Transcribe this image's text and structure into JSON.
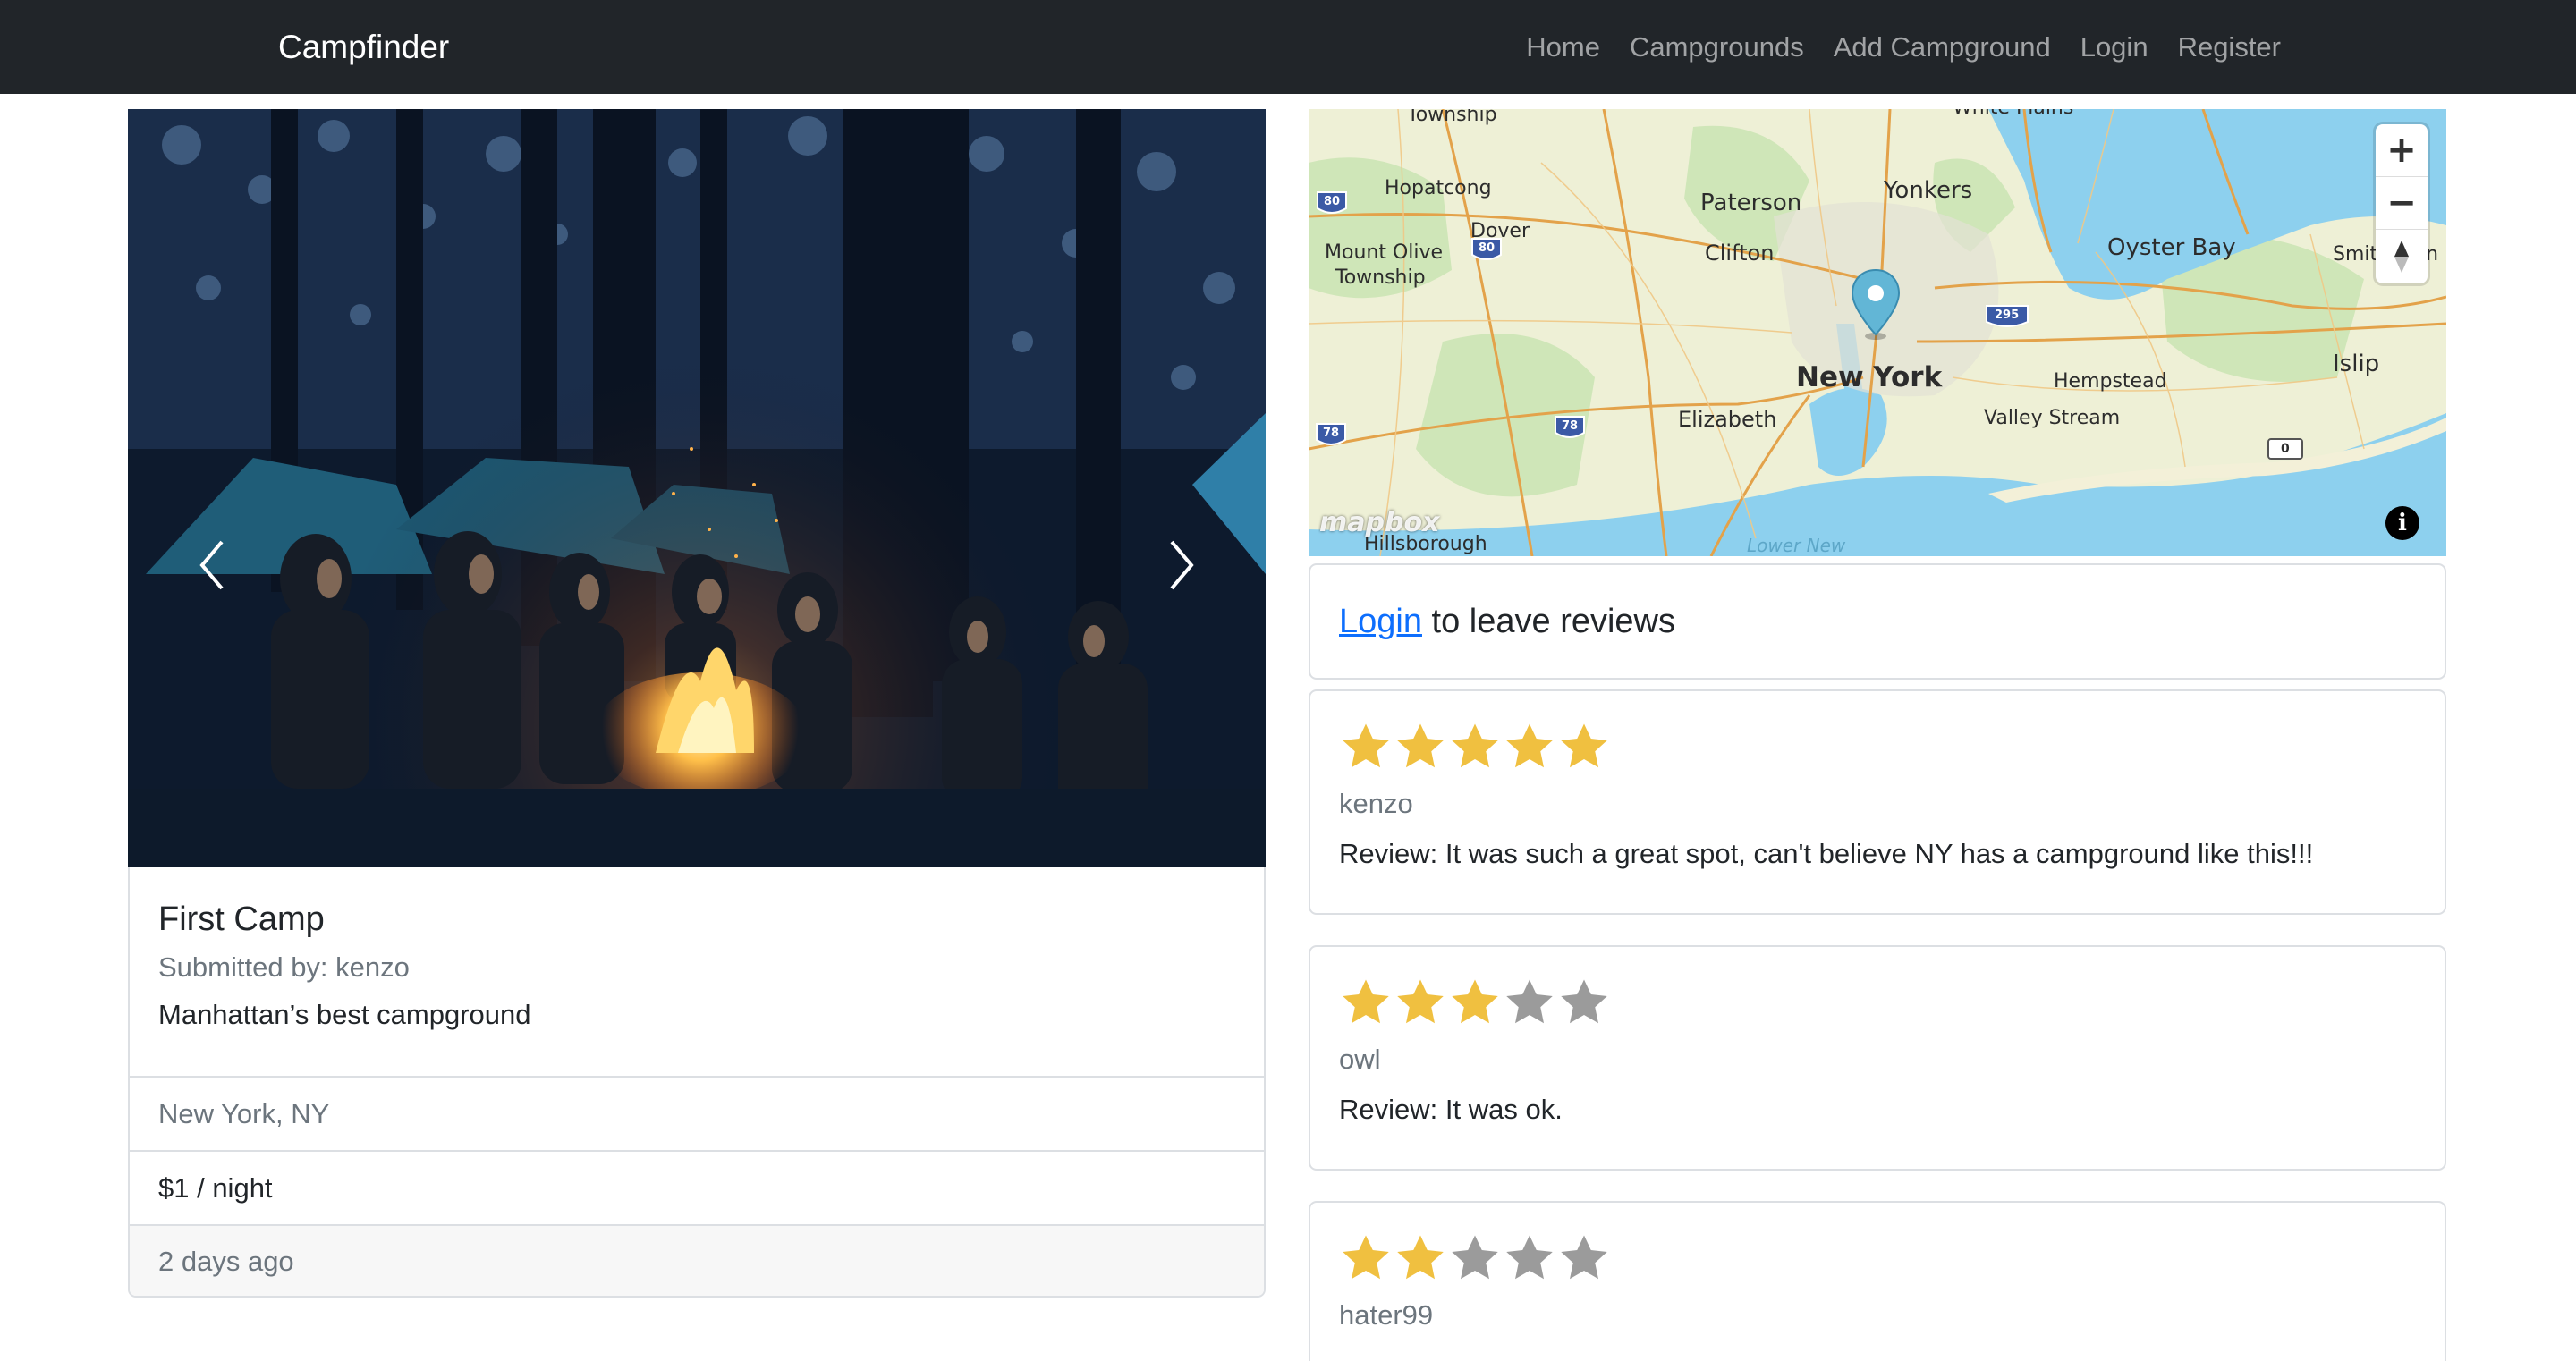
{
  "navbar": {
    "brand": "Campfinder",
    "links": [
      "Home",
      "Campgrounds",
      "Add Campground",
      "Login",
      "Register"
    ]
  },
  "carousel": {
    "prev_icon": "chevron-left-icon",
    "next_icon": "chevron-right-icon"
  },
  "campground": {
    "title": "First Camp",
    "submitted_by": "Submitted by: kenzo",
    "description": "Manhattan’s best campground",
    "location": "New York, NY",
    "price": "$1 / night",
    "posted": "2 days ago"
  },
  "map": {
    "labels": {
      "township_top": "Township",
      "white_plains": "White Plains",
      "hopatcong": "Hopatcong",
      "paterson": "Paterson",
      "yonkers": "Yonkers",
      "dover": "Dover",
      "mount_olive_1": "Mount Olive",
      "mount_olive_2": "Township",
      "clifton": "Clifton",
      "oyster_bay": "Oyster Bay",
      "smithtown": "Smithtown",
      "islip": "Islip",
      "new_york": "New York",
      "hempstead": "Hempstead",
      "elizabeth": "Elizabeth",
      "valley_stream": "Valley Stream",
      "hillsborough": "Hillsborough",
      "lower_new": "Lower New"
    },
    "shields": {
      "i80_west": "80",
      "i80_mid": "80",
      "i295": "295",
      "i78_west": "78",
      "i78_mid": "78",
      "route0": "0"
    },
    "zoom_in": "+",
    "zoom_out": "−",
    "compass_icon": "compass-icon",
    "attribution": "mapbox",
    "info": "i"
  },
  "reviews_prompt": {
    "link": "Login",
    "rest": " to leave reviews"
  },
  "reviews": [
    {
      "rating": 5,
      "max": 5,
      "author": "kenzo",
      "text": "Review: It was such a great spot, can't believe NY has a campground like this!!!"
    },
    {
      "rating": 3,
      "max": 5,
      "author": "owl",
      "text": "Review: It was ok."
    },
    {
      "rating": 2,
      "max": 5,
      "author": "hater99",
      "text": ""
    }
  ],
  "colors": {
    "navbar_bg": "#212529",
    "star_filled": "#f0c040",
    "star_empty": "#9b9b9b",
    "link": "#0d6efd",
    "marker": "#62b6d6",
    "water": "#8dd0ee"
  }
}
